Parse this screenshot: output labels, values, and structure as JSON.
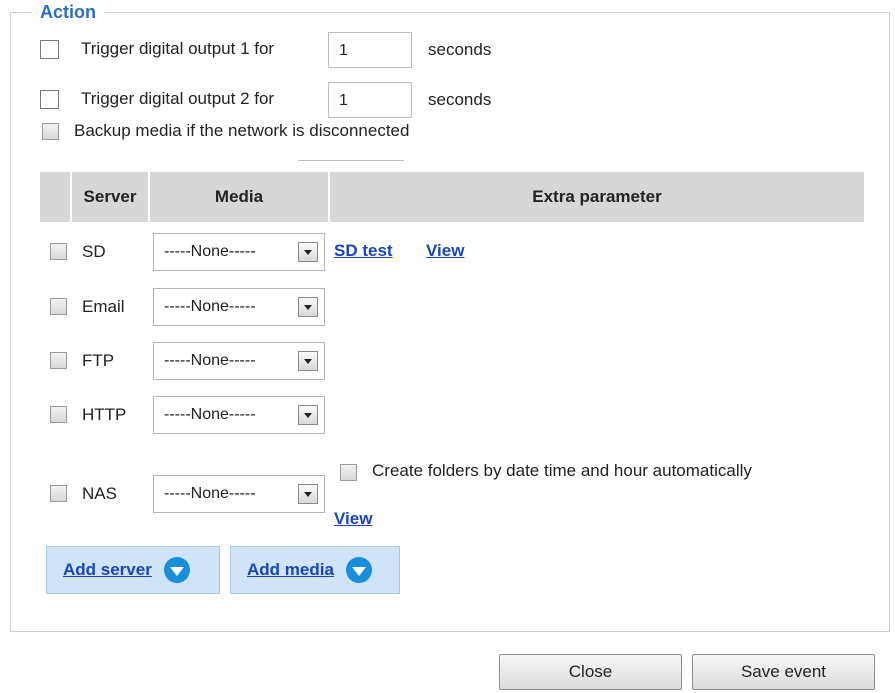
{
  "action": {
    "legend": "Action",
    "trigger1": {
      "label": "Trigger digital output 1 for",
      "value": "1",
      "unit": "seconds"
    },
    "trigger2": {
      "label": "Trigger digital output 2 for",
      "value": "1",
      "unit": "seconds"
    },
    "backup_label": "Backup media if the network is disconnected"
  },
  "table": {
    "headers": {
      "server": "Server",
      "media": "Media",
      "extra": "Extra parameter"
    },
    "rows": [
      {
        "server": "SD",
        "media": "-----None-----",
        "links": [
          "SD test",
          "View"
        ]
      },
      {
        "server": "Email",
        "media": "-----None-----"
      },
      {
        "server": "FTP",
        "media": "-----None-----"
      },
      {
        "server": "HTTP",
        "media": "-----None-----"
      },
      {
        "server": "NAS",
        "media": "-----None-----",
        "extra_checkbox": "Create folders by date time and hour automatically",
        "links": [
          "View"
        ]
      }
    ]
  },
  "buttons": {
    "add_server": "Add server",
    "add_media": "Add media",
    "close": "Close",
    "save_event": "Save event"
  },
  "icons": [
    "checkbox-icon",
    "dropdown-arrow-icon",
    "expand-circle-icon"
  ],
  "colors": {
    "accent": "#2a6fc0",
    "link": "#1a44b8",
    "add_bg": "#cfe4f6",
    "add_icon": "#1a8ed8",
    "header_bg": "#d7d7d7"
  }
}
